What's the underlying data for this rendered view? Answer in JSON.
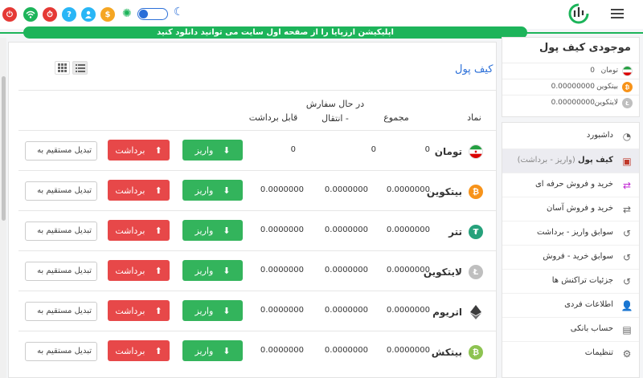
{
  "header": {
    "banner_text": "اپلیکیشن ارزپایا را از صفحه اول سایت می توانید دانلود کنید",
    "theme_toggle": "off",
    "icons": [
      "power-icon",
      "wifi-icon",
      "notification-icon",
      "help-icon",
      "user-icon",
      "dollar-icon",
      "sun-icon",
      "moon-icon",
      "logo-icon",
      "menu-icon"
    ]
  },
  "wallet": {
    "title": "کیف پول",
    "columns": {
      "symbol": "نماد",
      "total": "مجموع",
      "in_order": "در حال سفارش - انتقال",
      "withdrawable": "قابل برداشت"
    },
    "deposit_label": "واریز",
    "withdraw_label": "برداشت",
    "convert_placeholder": "تبدیل مستقیم به",
    "rows": [
      {
        "name": "تومان",
        "total": "0",
        "in_order": "0",
        "withdrawable": "0",
        "icon": "iran-flag-icon",
        "color": "#ffffff"
      },
      {
        "name": "بیتکوین",
        "total": "0.0000000",
        "in_order": "0.0000000",
        "withdrawable": "0.0000000",
        "icon": "bitcoin-icon",
        "color": "#f7931a"
      },
      {
        "name": "تتر",
        "total": "0.0000000",
        "in_order": "0.0000000",
        "withdrawable": "0.0000000",
        "icon": "tether-icon",
        "color": "#26a17b"
      },
      {
        "name": "لایتکوین",
        "total": "0.0000000",
        "in_order": "0.0000000",
        "withdrawable": "0.0000000",
        "icon": "litecoin-icon",
        "color": "#bfbfbf"
      },
      {
        "name": "اتریوم",
        "total": "0.0000000",
        "in_order": "0.0000000",
        "withdrawable": "0.0000000",
        "icon": "ethereum-icon",
        "color": "#3c3c3d"
      },
      {
        "name": "بیتکش",
        "total": "0.0000000",
        "in_order": "0.0000000",
        "withdrawable": "0.0000000",
        "icon": "bitcoin-cash-icon",
        "color": "#8dc351"
      }
    ]
  },
  "balance": {
    "title": "موجودی کیف پول",
    "items": [
      {
        "name": "تومان",
        "value": "0",
        "icon": "iran-flag-icon"
      },
      {
        "name": "بیتکوین",
        "value": "0.00000000",
        "icon": "bitcoin-icon"
      },
      {
        "name": "لایتکوین",
        "value": "0.00000000",
        "icon": "litecoin-icon"
      }
    ]
  },
  "menu": {
    "items": [
      {
        "label": "داشبورد",
        "icon": "dashboard-icon"
      },
      {
        "label": "کیف پول",
        "sub": "(واریز - برداشت)",
        "icon": "wallet-icon"
      },
      {
        "label": "خرید و فروش حرفه ای",
        "icon": "exchange-pro-icon"
      },
      {
        "label": "خرید و فروش آسان",
        "icon": "exchange-easy-icon"
      },
      {
        "label": "سوابق واریز - برداشت",
        "icon": "history-icon"
      },
      {
        "label": "سوابق خرید - فروش",
        "icon": "history-icon"
      },
      {
        "label": "جزئیات تراکنش ها",
        "icon": "history-icon"
      },
      {
        "label": "اطلاعات فردی",
        "icon": "person-icon"
      },
      {
        "label": "حساب بانکی",
        "icon": "bank-icon"
      },
      {
        "label": "تنظیمات",
        "icon": "settings-icon"
      }
    ]
  },
  "colors": {
    "accent": "#1db45a",
    "deposit": "#33b45c",
    "withdraw": "#e74849",
    "link": "#2b6fd8",
    "active_menu": "#ececf1"
  }
}
